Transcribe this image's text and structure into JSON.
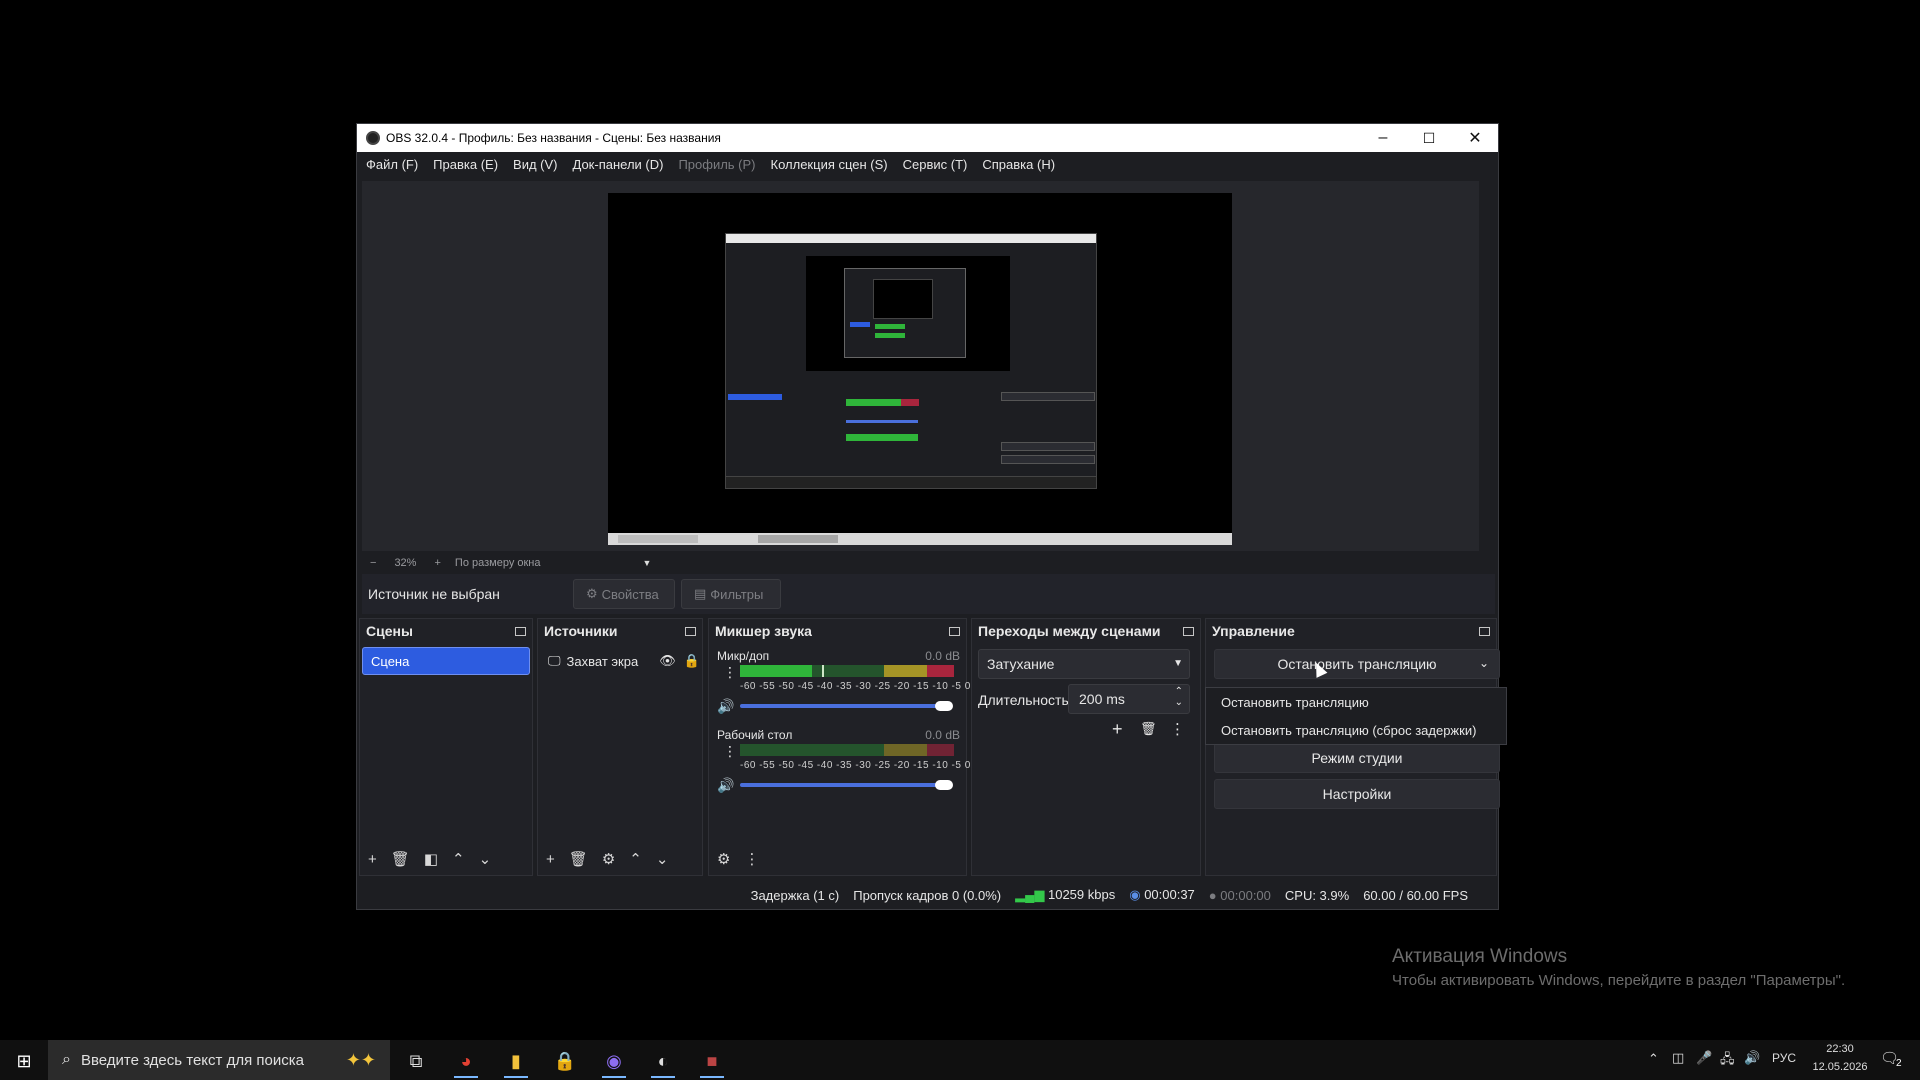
{
  "window": {
    "title": "OBS 32.0.4 - Профиль: Без названия - Сцены: Без названия",
    "minimize": "–",
    "maximize": "☐",
    "close": "✕"
  },
  "menu": {
    "items": [
      "Файл (F)",
      "Правка (E)",
      "Вид (V)",
      "Док-панели (D)",
      "Профиль (P)",
      "Коллекция сцен (S)",
      "Сервис (T)",
      "Справка (H)"
    ]
  },
  "zoom": {
    "minus": "−",
    "value": "32%",
    "plus": "+",
    "mode": "По размеру окна"
  },
  "source_bar": {
    "label": "Источник не выбран",
    "properties": "Свойства",
    "filters": "Фильтры"
  },
  "scenes": {
    "title": "Сцены",
    "items": [
      "Сцена"
    ]
  },
  "sources": {
    "title": "Источники",
    "items": [
      "Захват экра"
    ]
  },
  "mixer": {
    "title": "Микшер звука",
    "ticks": "-60 -55 -50 -45 -40 -35 -30 -25 -20 -15 -10 -5 0",
    "channels": [
      {
        "name": "Микр/доп",
        "db": "0.0 dB",
        "level": 0.45
      },
      {
        "name": "Рабочий стол",
        "db": "0.0 dB",
        "level": 0.0
      }
    ]
  },
  "transitions": {
    "title": "Переходы между сценами",
    "selected": "Затухание",
    "duration_label": "Длительность",
    "duration_value": "200 ms"
  },
  "controls": {
    "title": "Управление",
    "stop_stream": "Остановить трансляцию",
    "studio_mode": "Режим студии",
    "settings": "Настройки"
  },
  "popup": {
    "items": [
      "Остановить трансляцию",
      "Остановить трансляцию (сброс задержки)"
    ]
  },
  "status": {
    "delay": "Задержка (1 с)",
    "dropped": "Пропуск кадров 0 (0.0%)",
    "bitrate": "10259 kbps",
    "stream_time": "00:00:37",
    "rec_time": "00:00:00",
    "cpu": "CPU: 3.9%",
    "fps": "60.00 / 60.00 FPS"
  },
  "watermark": {
    "line1": "Активация Windows",
    "line2": "Чтобы активировать Windows, перейдите в раздел \"Параметры\"."
  },
  "taskbar": {
    "search_placeholder": "Введите здесь текст для поиска",
    "lang": "РУС",
    "time": "22:30",
    "date": "12.05.2026",
    "notifications": "2"
  },
  "colors": {
    "accent": "#2d5ce0",
    "background": "#1d1e22",
    "meter_green": "#2fb53a",
    "meter_yellow": "#a59426",
    "meter_red": "#a8253d"
  }
}
